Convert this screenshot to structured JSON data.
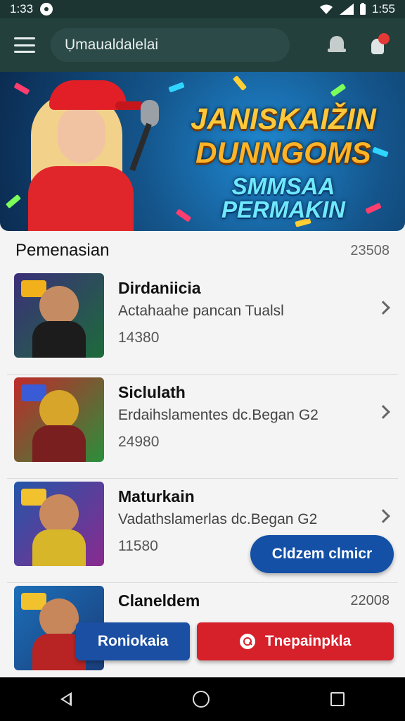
{
  "status_bar": {
    "time_left": "1:33",
    "time_right": "1:55"
  },
  "app_bar": {
    "search_text": "Ụmaualdalelai",
    "icons": [
      "menu-icon",
      "bell-icon",
      "bulb-icon"
    ],
    "accent": "#23403d"
  },
  "banner": {
    "line1": "JANISKAIŽIN",
    "line2": "DUNNGOMS",
    "line3": "SMMSAA PERMAKIN"
  },
  "section": {
    "title": "Pemenasian",
    "count": "23508"
  },
  "items": [
    {
      "title": "Dirdaniicia",
      "subtitle": "Actahaahe pancan Tualsl",
      "value": "14380",
      "right_value": ""
    },
    {
      "title": "Siclulath",
      "subtitle": "Erdaihslamentes dc.Began G2",
      "value": "24980",
      "right_value": ""
    },
    {
      "title": "Maturkain",
      "subtitle": "Vadathslamerlas dc.Began G2",
      "value": "11580",
      "right_value": ""
    },
    {
      "title": "Claneldem",
      "subtitle": "",
      "value": "",
      "right_value": "22008"
    }
  ],
  "buttons": {
    "fab": "Cldzem clmicr",
    "secondary": "Roniokaia",
    "primary": "Tnepainpkla"
  },
  "colors": {
    "primary_red": "#d6202a",
    "primary_blue": "#1350a6"
  }
}
